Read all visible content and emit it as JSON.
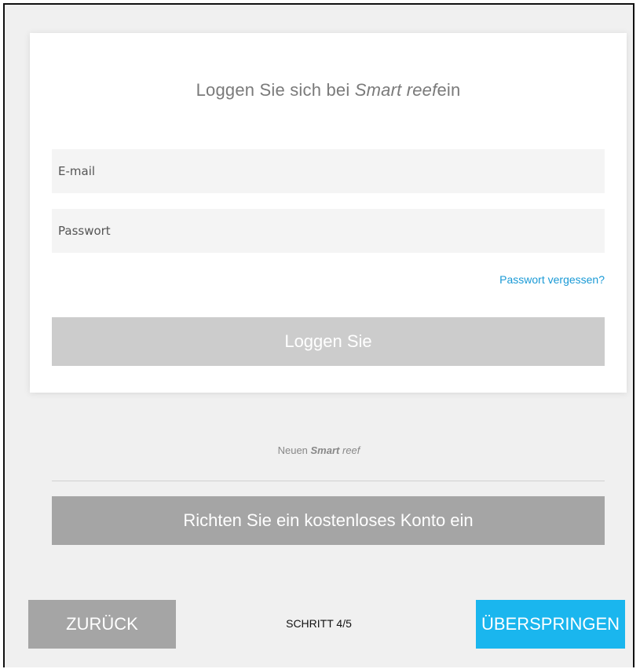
{
  "login_card": {
    "title_prefix": "Loggen Sie sich bei ",
    "title_brand": "Smart reef",
    "title_suffix": "ein",
    "email_placeholder": "E-mail",
    "password_placeholder": "Passwort",
    "forgot_password": "Passwort vergessen?",
    "login_button": "Loggen Sie"
  },
  "new_account": {
    "text_prefix": "Neuen ",
    "brand_strong": "Smart",
    "brand_rest": " reef",
    "create_button": "Richten Sie ein kostenloses Konto ein"
  },
  "footer": {
    "back_button": "ZURÜCK",
    "step_label": "SCHRITT 4/5",
    "skip_button": "ÜBERSPRINGEN"
  },
  "colors": {
    "accent": "#1ab6ee",
    "link": "#1a9ad6",
    "disabled_button": "#cccccc",
    "secondary_button": "#a5a5a5",
    "background": "#f0f0f0"
  }
}
